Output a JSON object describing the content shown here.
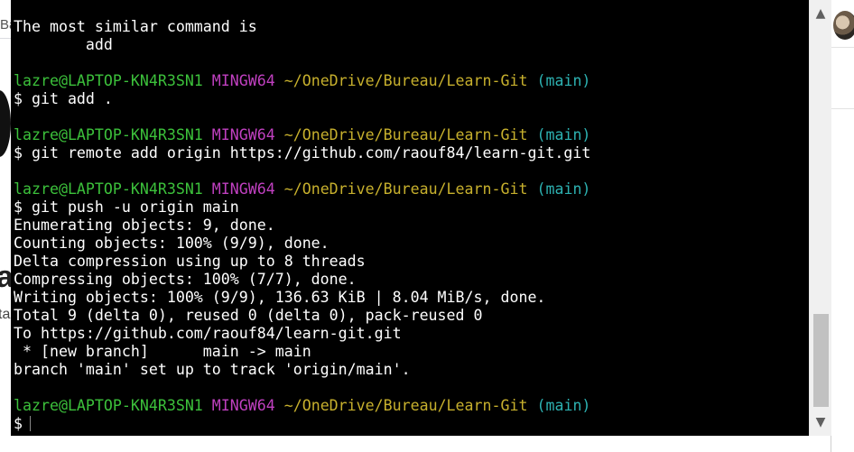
{
  "background_page": {
    "tab_fragment": "Ba",
    "heading_fragment": "a",
    "sub_fragment": "ta"
  },
  "terminal": {
    "lines": [
      [
        {
          "t": "The most similar command is",
          "c": ""
        }
      ],
      [
        {
          "t": "        add",
          "c": ""
        }
      ],
      [],
      [
        {
          "t": "lazre@LAPTOP-KN4R3SN1",
          "c": "user"
        },
        {
          "t": " ",
          "c": ""
        },
        {
          "t": "MINGW64",
          "c": "env"
        },
        {
          "t": " ",
          "c": ""
        },
        {
          "t": "~/OneDrive/Bureau/Learn-Git",
          "c": "path"
        },
        {
          "t": " ",
          "c": ""
        },
        {
          "t": "(main)",
          "c": "branch"
        }
      ],
      [
        {
          "t": "$ git add .",
          "c": ""
        }
      ],
      [],
      [
        {
          "t": "lazre@LAPTOP-KN4R3SN1",
          "c": "user"
        },
        {
          "t": " ",
          "c": ""
        },
        {
          "t": "MINGW64",
          "c": "env"
        },
        {
          "t": " ",
          "c": ""
        },
        {
          "t": "~/OneDrive/Bureau/Learn-Git",
          "c": "path"
        },
        {
          "t": " ",
          "c": ""
        },
        {
          "t": "(main)",
          "c": "branch"
        }
      ],
      [
        {
          "t": "$ git remote add origin https://github.com/raouf84/learn-git.git",
          "c": ""
        }
      ],
      [],
      [
        {
          "t": "lazre@LAPTOP-KN4R3SN1",
          "c": "user"
        },
        {
          "t": " ",
          "c": ""
        },
        {
          "t": "MINGW64",
          "c": "env"
        },
        {
          "t": " ",
          "c": ""
        },
        {
          "t": "~/OneDrive/Bureau/Learn-Git",
          "c": "path"
        },
        {
          "t": " ",
          "c": ""
        },
        {
          "t": "(main)",
          "c": "branch"
        }
      ],
      [
        {
          "t": "$ git push -u origin main",
          "c": ""
        }
      ],
      [
        {
          "t": "Enumerating objects: 9, done.",
          "c": ""
        }
      ],
      [
        {
          "t": "Counting objects: 100% (9/9), done.",
          "c": ""
        }
      ],
      [
        {
          "t": "Delta compression using up to 8 threads",
          "c": ""
        }
      ],
      [
        {
          "t": "Compressing objects: 100% (7/7), done.",
          "c": ""
        }
      ],
      [
        {
          "t": "Writing objects: 100% (9/9), 136.63 KiB | 8.04 MiB/s, done.",
          "c": ""
        }
      ],
      [
        {
          "t": "Total 9 (delta 0), reused 0 (delta 0), pack-reused 0",
          "c": ""
        }
      ],
      [
        {
          "t": "To https://github.com/raouf84/learn-git.git",
          "c": ""
        }
      ],
      [
        {
          "t": " * [new branch]      main -> main",
          "c": ""
        }
      ],
      [
        {
          "t": "branch 'main' set up to track 'origin/main'.",
          "c": ""
        }
      ],
      [],
      [
        {
          "t": "lazre@LAPTOP-KN4R3SN1",
          "c": "user"
        },
        {
          "t": " ",
          "c": ""
        },
        {
          "t": "MINGW64",
          "c": "env"
        },
        {
          "t": " ",
          "c": ""
        },
        {
          "t": "~/OneDrive/Bureau/Learn-Git",
          "c": "path"
        },
        {
          "t": " ",
          "c": ""
        },
        {
          "t": "(main)",
          "c": "branch"
        }
      ],
      [
        {
          "t": "$",
          "c": "",
          "cursor": true
        }
      ]
    ]
  },
  "colors": {
    "background": "#000000",
    "text": "#ffffff",
    "user": "#3cc13b",
    "env": "#c040c0",
    "path": "#c7b02d",
    "branch": "#2db2b2"
  },
  "scrollbar": {
    "up_icon": "▲",
    "down_icon": "▼",
    "position_fraction": 0.92
  }
}
